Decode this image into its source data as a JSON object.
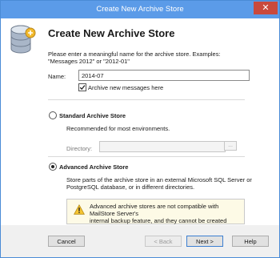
{
  "window": {
    "title": "Create New Archive Store",
    "close_glyph": "✕"
  },
  "header": {
    "title": "Create New Archive Store",
    "icon": "database-icon"
  },
  "intro": {
    "line1": "Please enter a meaningful name for the archive store. Examples:",
    "line2": "\"Messages 2012\" or \"2012-01\""
  },
  "name_field": {
    "label": "Name:",
    "value": "2014-07"
  },
  "archive_new": {
    "label": "Archive new messages here",
    "checked": true
  },
  "standard": {
    "label": "Standard Archive Store",
    "selected": false,
    "description": "Recommended for most environments.",
    "directory_label": "Directory:",
    "directory_value": "",
    "browse_label": "..."
  },
  "advanced": {
    "label": "Advanced Archive Store",
    "selected": true,
    "description_line1": "Store parts of the archive store in an external Microsoft SQL Server or",
    "description_line2": "PostgreSQL database, or in different directories."
  },
  "warning": {
    "icon": "warning-icon",
    "line1": "Advanced archive stores are not compatible with MailStore Server's",
    "line2": "internal backup feature, and they cannot be created automatically."
  },
  "buttons": {
    "cancel": "Cancel",
    "back": "< Back",
    "next": "Next >",
    "help": "Help"
  },
  "colors": {
    "titlebar": "#5b9be8",
    "close": "#c9493d",
    "warning_bg": "#fdfae6"
  }
}
